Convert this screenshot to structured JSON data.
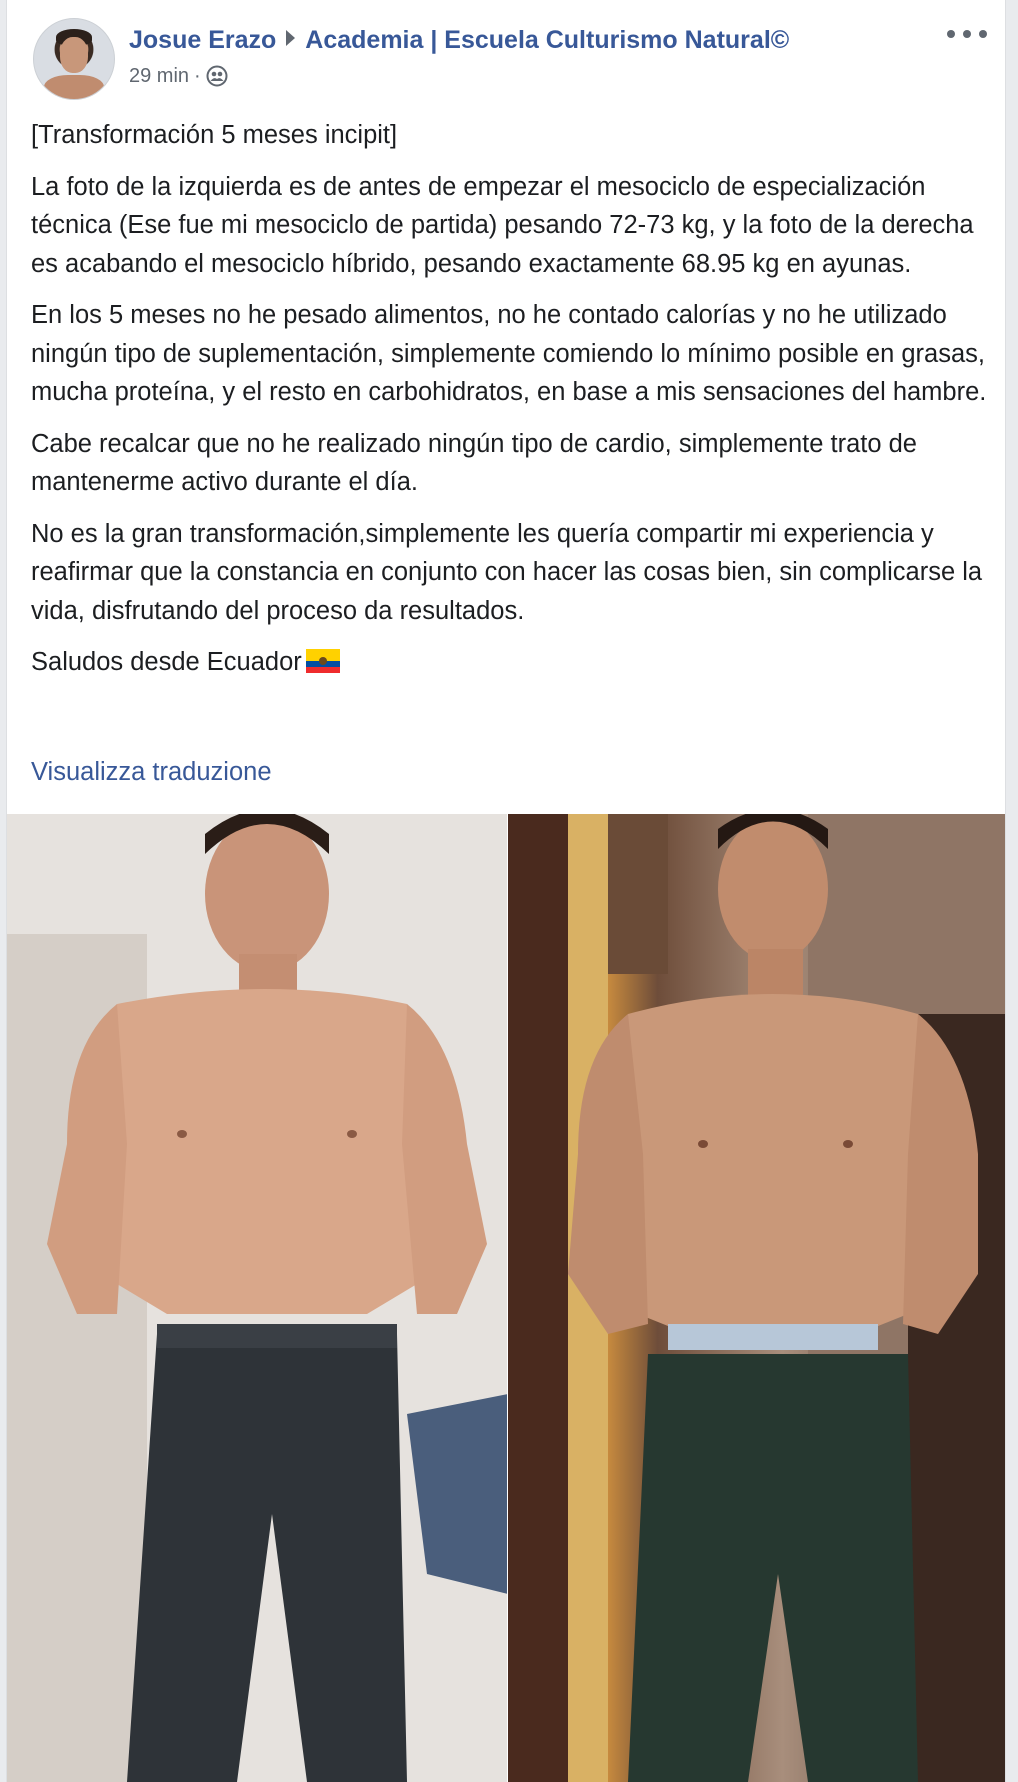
{
  "post": {
    "author": "Josue Erazo",
    "group": "Academia | Escuela Culturismo Natural©",
    "time": "29 min",
    "meta_separator": "·",
    "privacy_icon": "group-icon",
    "more_icon": "more-options-icon",
    "paragraphs": [
      "[Transformación 5 meses incipit]",
      "La foto de la izquierda es de antes de empezar el mesociclo de especialización técnica (Ese fue mi mesociclo de partida) pesando 72-73 kg, y la foto de la derecha es acabando el mesociclo híbrido, pesando exactamente 68.95 kg en ayunas.",
      "En los 5 meses no he pesado alimentos, no he contado calorías y no he utilizado ningún tipo de suplementación, simplemente comiendo lo mínimo posible en grasas, mucha proteína, y el resto en carbohidratos, en base a mis sensaciones del hambre.",
      "Cabe recalcar que no he realizado ningún tipo de cardio, simplemente trato de mantenerme activo durante el día.",
      "No es la gran transformación,simplemente les quería compartir mi experiencia y reafirmar que la constancia en conjunto con hacer las cosas bien, sin complicarse la vida, disfrutando del proceso da resultados.",
      "Saludos desde Ecuador"
    ],
    "flag_icon": "ecuador-flag-icon",
    "translate_label": "Visualizza traduzione"
  },
  "colors": {
    "link": "#385898",
    "text": "#1c1e21",
    "meta": "#606770",
    "background": "#e9ebee"
  }
}
